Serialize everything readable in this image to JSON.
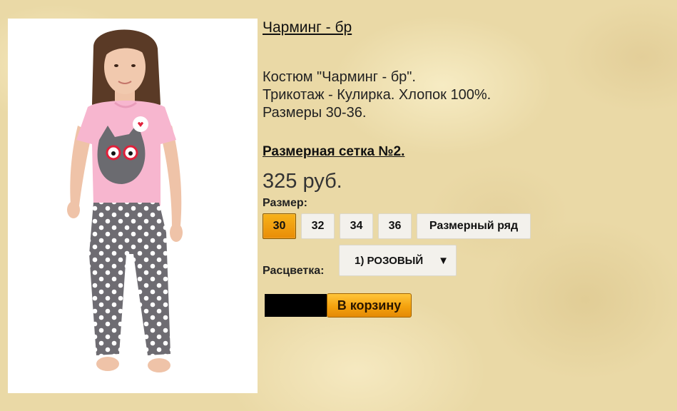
{
  "product": {
    "title": "Чарминг - бр",
    "description": [
      "Костюм \"Чарминг - бр\".",
      "Трикотаж - Кулирка. Хлопок 100%.",
      "Размеры 30-36."
    ],
    "size_chart_link": "Размерная сетка №2.",
    "price": "325 руб.",
    "image_alt": "girl-in-pink-tshirt-with-cat-and-grey-polka-dot-pants"
  },
  "size": {
    "label": "Размер:",
    "options": [
      "30",
      "32",
      "34",
      "36"
    ],
    "selected": "30",
    "range_button": "Размерный ряд"
  },
  "color": {
    "label": "Расцветка:",
    "selected": "1) РОЗОВЫЙ",
    "chevron_icon": "triangle-down-icon"
  },
  "cart": {
    "button_label": "В корзину"
  },
  "colors": {
    "background": "#ead9a6",
    "accent": "#f4a20e",
    "shirt": "#f7b6cf",
    "pants": "#6e6c72"
  }
}
